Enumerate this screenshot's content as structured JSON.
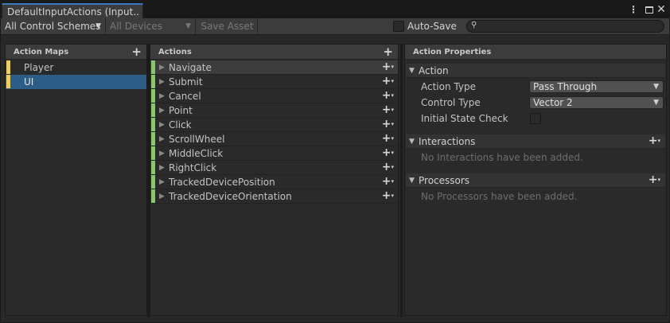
{
  "window": {
    "tab_title": "DefaultInputActions (Input...",
    "kebab_glyph": "⋮",
    "close_glyph": "✕"
  },
  "toolbar": {
    "control_scheme": "All Control Schemes",
    "devices": "All Devices",
    "save_asset": "Save Asset",
    "auto_save_label": "Auto-Save",
    "auto_save_checked": false,
    "search_value": "",
    "search_glyph": "⚲",
    "dropdown_arrow": "▼"
  },
  "action_maps": {
    "title": "Action Maps",
    "add_glyph": "+",
    "items": [
      {
        "label": "Player",
        "selected": false
      },
      {
        "label": "UI",
        "selected": true
      }
    ]
  },
  "actions": {
    "title": "Actions",
    "add_glyph": "+",
    "row_add_glyph": "+",
    "row_add_sub": "▾",
    "expand_glyph": "▶",
    "items": [
      {
        "label": "Navigate"
      },
      {
        "label": "Submit"
      },
      {
        "label": "Cancel"
      },
      {
        "label": "Point"
      },
      {
        "label": "Click"
      },
      {
        "label": "ScrollWheel"
      },
      {
        "label": "MiddleClick"
      },
      {
        "label": "RightClick"
      },
      {
        "label": "TrackedDevicePosition"
      },
      {
        "label": "TrackedDeviceOrientation"
      }
    ]
  },
  "properties": {
    "title": "Action Properties",
    "collapse_glyph": "▼",
    "action_section": {
      "label": "Action",
      "action_type_label": "Action Type",
      "action_type_value": "Pass Through",
      "control_type_label": "Control Type",
      "control_type_value": "Vector 2",
      "initial_state_label": "Initial State Check",
      "initial_state_checked": false
    },
    "interactions": {
      "label": "Interactions",
      "empty": "No Interactions have been added."
    },
    "processors": {
      "label": "Processors",
      "empty": "No Processors have been added."
    }
  },
  "colors": {
    "selection": "#2c5d87",
    "map_stripe": "#e9cd67",
    "action_stripe": "#8dc474",
    "tab_accent": "#3a79bb"
  }
}
